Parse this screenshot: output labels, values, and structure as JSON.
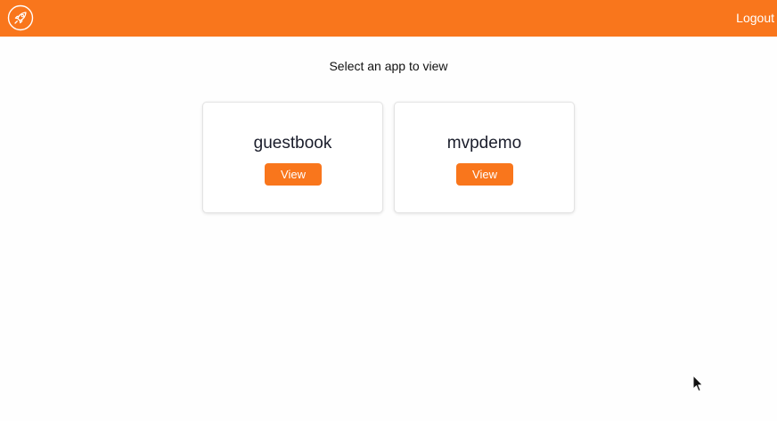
{
  "header": {
    "logo_icon": "rocket-icon",
    "logout_label": "Logout",
    "background_color": "#f9761c"
  },
  "main": {
    "prompt": "Select an app to view",
    "apps": [
      {
        "name": "guestbook",
        "button_label": "View"
      },
      {
        "name": "mvpdemo",
        "button_label": "View"
      }
    ]
  },
  "colors": {
    "accent": "#f9761c",
    "text": "#1a1d2b"
  },
  "cursor_icon": "arrow-cursor-icon"
}
